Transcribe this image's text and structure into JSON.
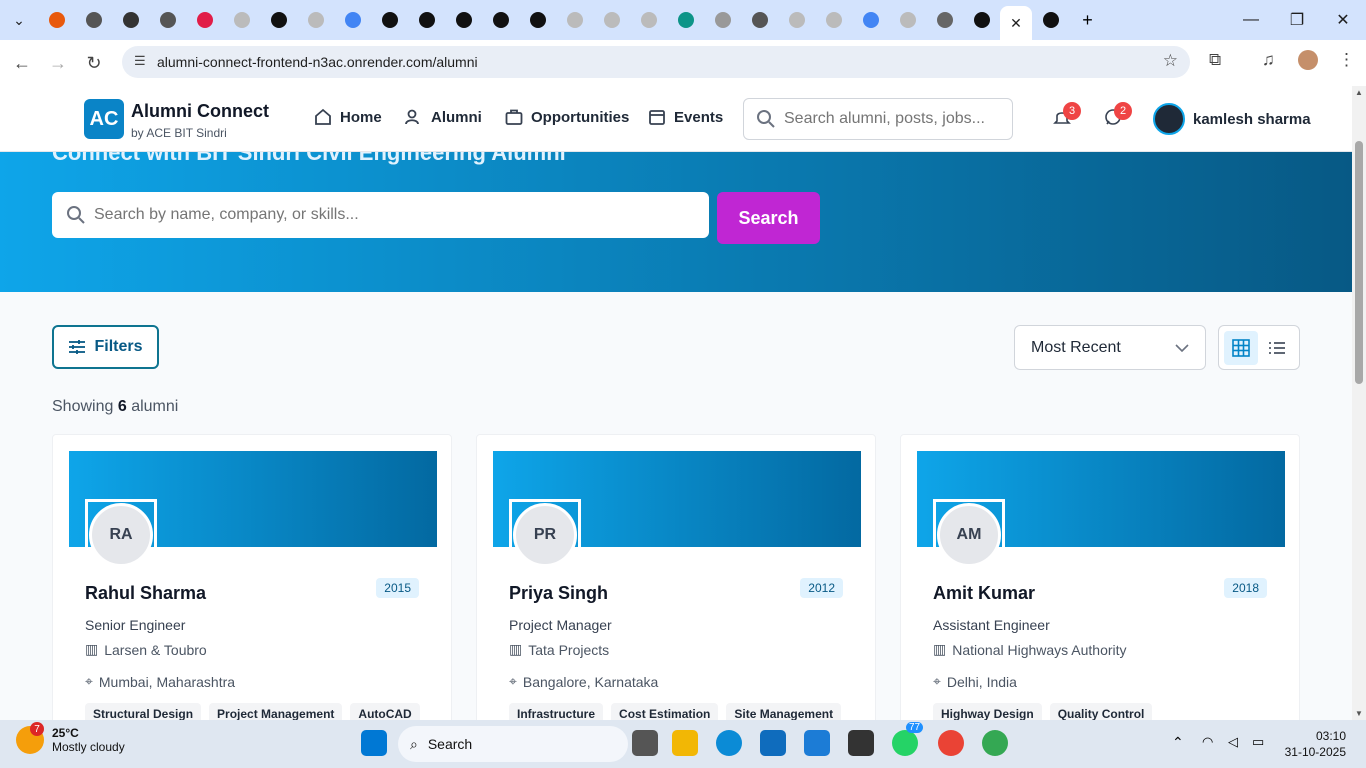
{
  "browser": {
    "url": "alumni-connect-frontend-n3ac.onrender.com/alumni",
    "tab_colors": [
      "#e8590c",
      "#555",
      "#333",
      "#555",
      "#e11d48",
      "#bbb",
      "#111",
      "#bbb",
      "#4285f4",
      "#111",
      "#111",
      "#111",
      "#111",
      "#111",
      "#bbb",
      "#bbb",
      "#bbb",
      "#0d9488",
      "#999",
      "#555",
      "#bbb",
      "#bbb",
      "#4285f4",
      "#bbb",
      "#666",
      "#111",
      "#111"
    ]
  },
  "header": {
    "logo": "AC",
    "brand": "Alumni Connect",
    "brand_sub": "by ACE BIT Sindri",
    "nav": [
      "Home",
      "Alumni",
      "Opportunities",
      "Events"
    ],
    "search_placeholder": "Search alumni, posts, jobs...",
    "notif_count": "3",
    "msg_count": "2",
    "user_name": "kamlesh sharma"
  },
  "hero": {
    "title": "Connect with BIT Sindri Civil Engineering Alumni",
    "search_placeholder": "Search by name, company, or skills...",
    "search_button": "Search"
  },
  "toolbar": {
    "filters": "Filters",
    "sort": "Most Recent",
    "showing_prefix": "Showing",
    "showing_count": "6",
    "showing_suffix": "alumni"
  },
  "cards": [
    {
      "initials": "RA",
      "name": "Rahul Sharma",
      "year": "2015",
      "role": "Senior Engineer",
      "company": "Larsen & Toubro",
      "location": "Mumbai, Maharashtra",
      "tags": [
        "Structural Design",
        "Project Management",
        "AutoCAD"
      ]
    },
    {
      "initials": "PR",
      "name": "Priya Singh",
      "year": "2012",
      "role": "Project Manager",
      "company": "Tata Projects",
      "location": "Bangalore, Karnataka",
      "tags": [
        "Infrastructure",
        "Cost Estimation",
        "Site Management"
      ]
    },
    {
      "initials": "AM",
      "name": "Amit Kumar",
      "year": "2018",
      "role": "Assistant Engineer",
      "company": "National Highways Authority",
      "location": "Delhi, India",
      "tags": [
        "Highway Design",
        "Quality Control"
      ]
    }
  ],
  "taskbar": {
    "weather_badge": "7",
    "temp": "25°C",
    "condition": "Mostly cloudy",
    "search": "Search",
    "whatsapp_badge": "77",
    "time": "03:10",
    "date": "31-10-2025"
  }
}
